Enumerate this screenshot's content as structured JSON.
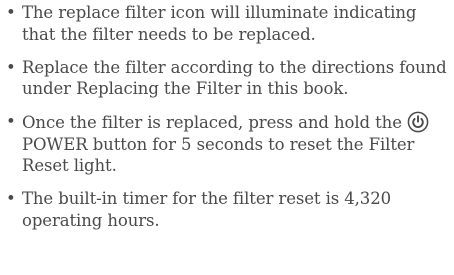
{
  "bullet_glyph": "•",
  "items": [
    {
      "text": "The replace filter icon will illuminate indicating that the filter needs to be replaced."
    },
    {
      "text": "Replace the filter according to the directions found under Replacing the Filter in this book."
    },
    {
      "text_before_icon": "Once the filter is replaced,  press and hold the",
      "icon": "power-icon",
      "text_after_icon": "POWER button for 5 seconds to reset the Filter Reset light."
    },
    {
      "text": "The built-in timer for the filter reset is 4,320 operating hours."
    }
  ]
}
